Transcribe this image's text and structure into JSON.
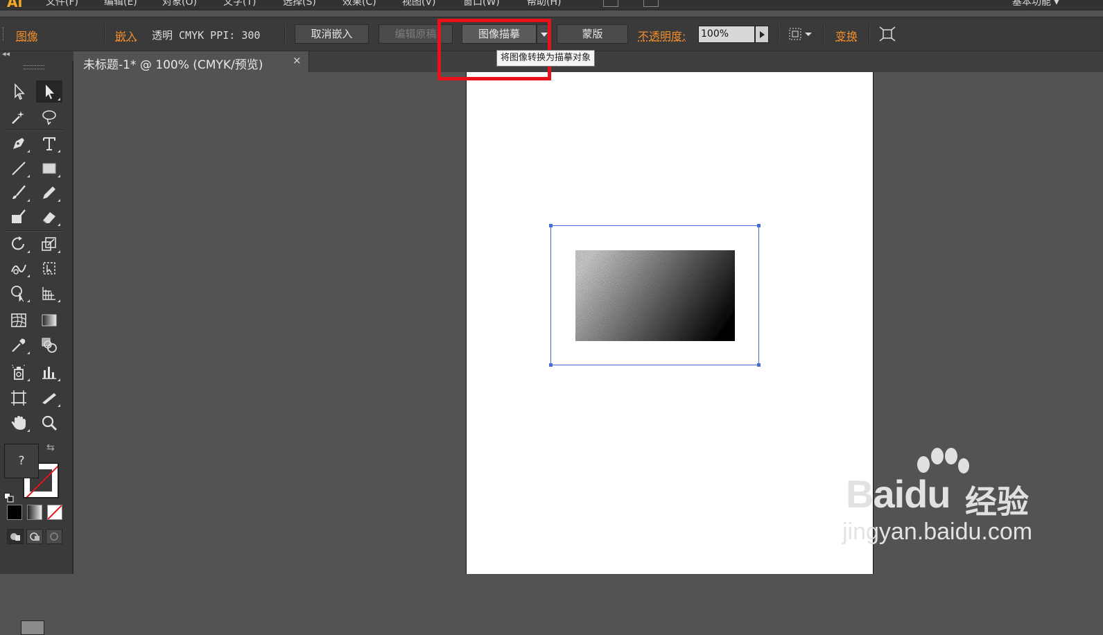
{
  "app": {
    "logo": "Ai"
  },
  "menubar": {
    "items": [
      "文件(F)",
      "编辑(E)",
      "对象(O)",
      "文字(T)",
      "选择(S)",
      "效果(C)",
      "视图(V)",
      "窗口(W)",
      "帮助(H)"
    ],
    "workspace_label": "基本功能 ▾"
  },
  "controlbar": {
    "object_type": "图像",
    "embed_link": "嵌入",
    "image_info": "透明  CMYK  PPI: 300",
    "unembed_button": "取消嵌入",
    "edit_original_button": "编辑原稿",
    "image_trace_button": "图像描摹",
    "mask_button": "蒙版",
    "opacity_label": "不透明度:",
    "opacity_value": "100%",
    "transform_link": "变换"
  },
  "tooltip": {
    "text": "将图像转换为描摹对象"
  },
  "document_tab": {
    "title": "未标题-1* @ 100% (CMYK/预览)",
    "close": "×"
  },
  "toolbox": {
    "fill_swatch_label": "?",
    "tools": [
      "selection",
      "direct-selection",
      "magic-wand",
      "lasso",
      "pen",
      "type",
      "line-segment",
      "rectangle",
      "paintbrush",
      "pencil",
      "blob-brush",
      "eraser",
      "rotate",
      "scale",
      "warp",
      "free-transform",
      "shape-builder",
      "graph",
      "mesh",
      "gradient",
      "eyedropper",
      "blend",
      "symbol-sprayer",
      "column-graph",
      "artboard",
      "slice",
      "hand",
      "zoom"
    ]
  },
  "watermark": {
    "brand": "Baidu",
    "cn": "经验",
    "url": "jingyan.baidu.com"
  },
  "colors": {
    "accent_link": "#f08c2b",
    "highlight": "#e8121b",
    "selection": "#4a6cdb"
  }
}
